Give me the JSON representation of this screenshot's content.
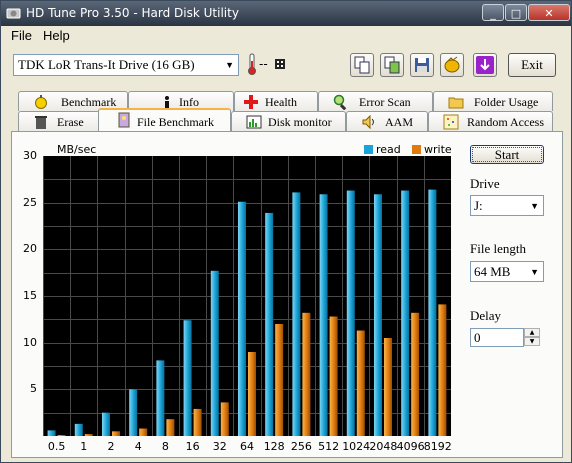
{
  "window": {
    "title": "HD Tune Pro 3.50 - Hard Disk Utility"
  },
  "menu": {
    "file": "File",
    "help": "Help"
  },
  "toolbar": {
    "drive": "TDK LoR Trans-It Drive (16 GB)",
    "temperature": "--",
    "exit_label": "Exit"
  },
  "tabs_row1": [
    {
      "label": "Benchmark",
      "icon": "stopwatch-icon"
    },
    {
      "label": "Info",
      "icon": "info-icon"
    },
    {
      "label": "Health",
      "icon": "cross-icon"
    },
    {
      "label": "Error Scan",
      "icon": "magnifier-icon"
    },
    {
      "label": "Folder Usage",
      "icon": "folder-icon"
    }
  ],
  "tabs_row2": [
    {
      "label": "Erase",
      "icon": "trash-icon"
    },
    {
      "label": "File Benchmark",
      "icon": "file-icon"
    },
    {
      "label": "Disk monitor",
      "icon": "monitor-icon"
    },
    {
      "label": "AAM",
      "icon": "speaker-icon"
    },
    {
      "label": "Random Access",
      "icon": "dots-icon"
    }
  ],
  "controls": {
    "start_label": "Start",
    "drive_label": "Drive",
    "drive_value": "J:",
    "file_length_label": "File length",
    "file_length_value": "64 MB",
    "delay_label": "Delay",
    "delay_value": "0"
  },
  "colors": {
    "read": "#1aa3d6",
    "write": "#e07a10"
  },
  "chart_data": {
    "type": "bar",
    "ylabel": "MB/sec",
    "ylim": [
      0,
      30
    ],
    "yticks": [
      5,
      10,
      15,
      20,
      25,
      30
    ],
    "categories": [
      "0.5",
      "1",
      "2",
      "4",
      "8",
      "16",
      "32",
      "64",
      "128",
      "256",
      "512",
      "1024",
      "2048",
      "4096",
      "8192"
    ],
    "series": [
      {
        "name": "read",
        "values": [
          0.6,
          1.3,
          2.5,
          5.0,
          8.1,
          12.4,
          17.7,
          25.1,
          23.9,
          26.1,
          25.9,
          26.3,
          25.9,
          26.3,
          26.4
        ]
      },
      {
        "name": "write",
        "values": [
          0.1,
          0.2,
          0.5,
          0.8,
          1.8,
          2.9,
          3.6,
          9.0,
          12.0,
          13.2,
          12.8,
          11.3,
          10.5,
          13.2,
          14.1
        ]
      }
    ],
    "grid": true,
    "legend": "top-right"
  }
}
